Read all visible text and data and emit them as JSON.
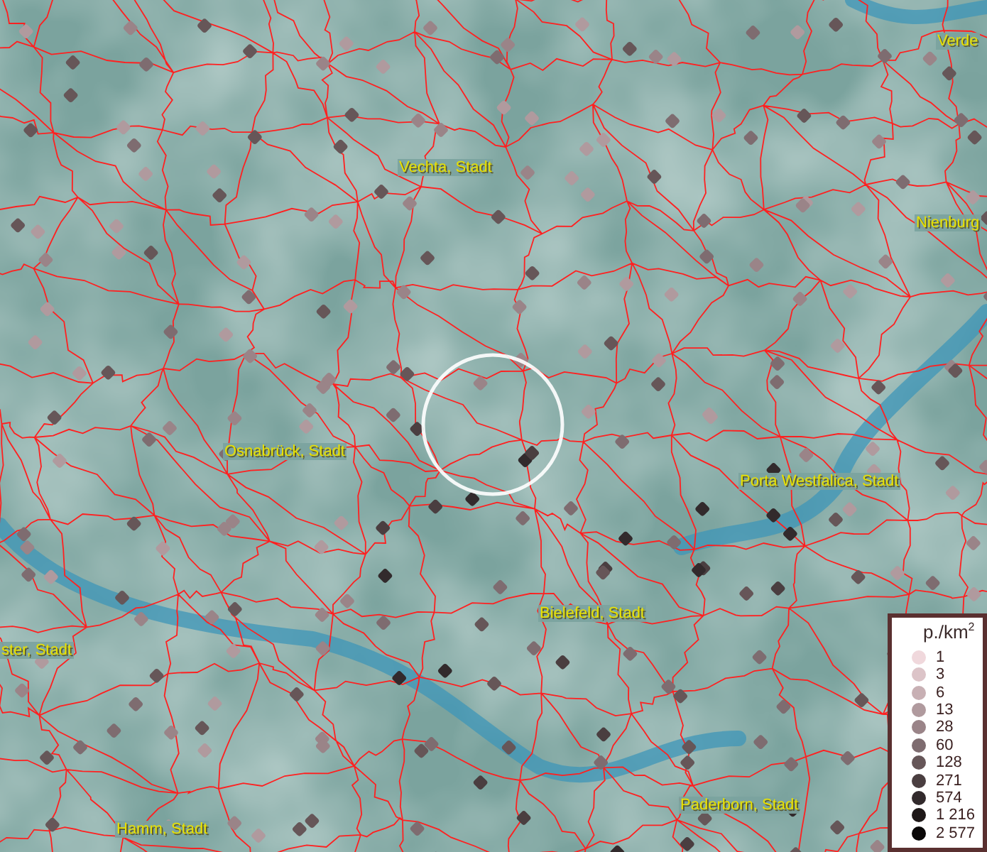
{
  "map": {
    "places": [
      {
        "name": "Verde"
      },
      {
        "name": "Vechta, Stadt"
      },
      {
        "name": "Nienburg"
      },
      {
        "name": "Osnabrück, Stadt"
      },
      {
        "name": "Porta Westfalica, Stadt"
      },
      {
        "name": "Bielefeld, Stadt"
      },
      {
        "name": "ster, Stadt"
      },
      {
        "name": "Hamm, Stadt"
      },
      {
        "name": "Paderborn, Stadt"
      }
    ]
  },
  "legend": {
    "title": "p./km$^{2}$",
    "items": [
      {
        "label": "1",
        "color": "#f0d8dc"
      },
      {
        "label": "3",
        "color": "#dcc4c8"
      },
      {
        "label": "6",
        "color": "#c8b0b4"
      },
      {
        "label": "13",
        "color": "#b09a9e"
      },
      {
        "label": "28",
        "color": "#9a8488"
      },
      {
        "label": "60",
        "color": "#7e6c70"
      },
      {
        "label": "128",
        "color": "#665658"
      },
      {
        "label": "271",
        "color": "#4a3e40"
      },
      {
        "label": "574",
        "color": "#322a2c"
      },
      {
        "label": "1 216",
        "color": "#1e1818"
      },
      {
        "label": "2 577",
        "color": "#0a0808"
      }
    ]
  }
}
